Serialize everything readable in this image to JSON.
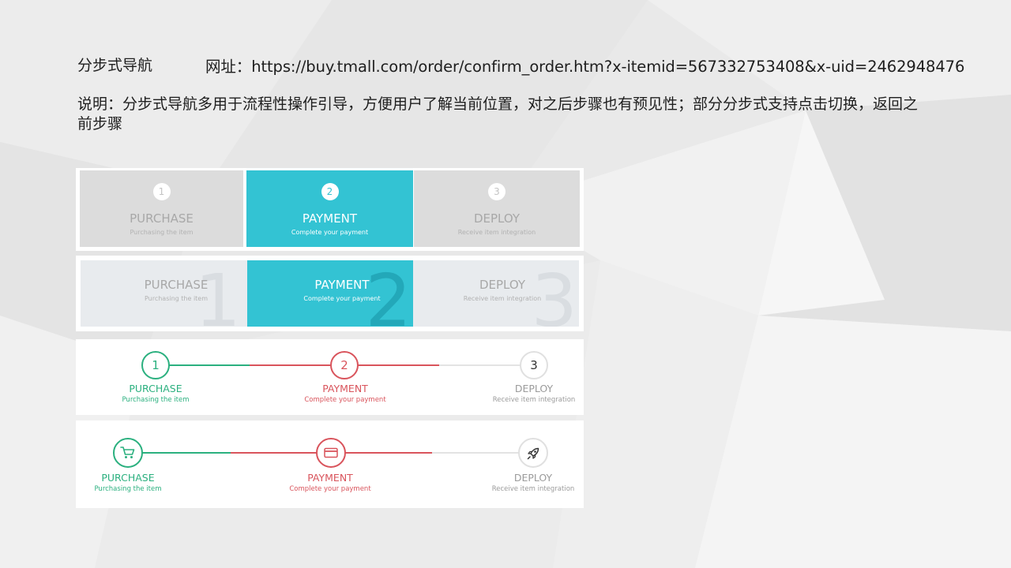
{
  "header": {
    "title": "分步式导航",
    "url": "网址：https://buy.tmall.com/order/confirm_order.htm?x-itemid=567332753408&x-uid=2462948476"
  },
  "description": "说明：分步式导航多用于流程性操作引导，方便用户了解当前位置，对之后步骤也有预见性；部分分步式支持点击切换，返回之前步骤",
  "steps": [
    {
      "number": "1",
      "title": "PURCHASE",
      "subtitle": "Purchasing the item",
      "icon": "cart-icon"
    },
    {
      "number": "2",
      "title": "PAYMENT",
      "subtitle": "Complete your payment",
      "icon": "credit-card-icon"
    },
    {
      "number": "3",
      "title": "DEPLOY",
      "subtitle": "Receive item integration",
      "icon": "rocket-icon"
    }
  ],
  "colors": {
    "cyan": "#33c3d3",
    "green": "#2bb07f",
    "red": "#d9545c",
    "grey": "#9b9b9b"
  }
}
